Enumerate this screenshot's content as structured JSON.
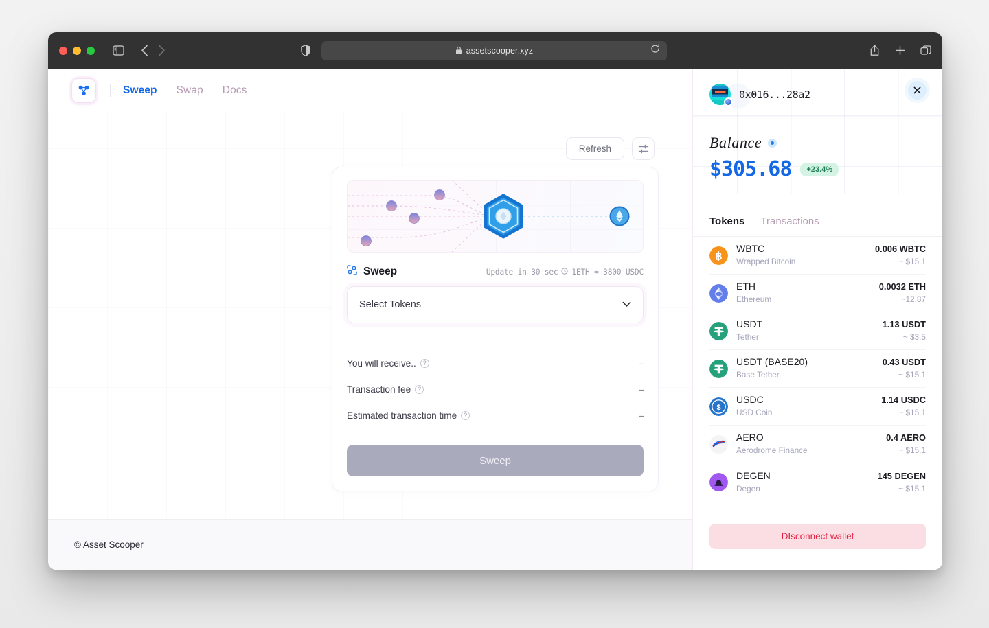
{
  "browser": {
    "url": "assetscooper.xyz",
    "lock_icon": "lock-icon",
    "reload_icon": "reload-icon",
    "sidebar_icon": "sidebar-toggle-icon",
    "back_icon": "chevron-left-icon",
    "forward_icon": "chevron-right-icon",
    "shield_icon": "shield-icon",
    "share_icon": "share-icon",
    "new_tab_icon": "plus-icon",
    "tabs_icon": "tab-overview-icon"
  },
  "nav": {
    "logo_icon": "asset-scooper-logo",
    "links": [
      {
        "label": "Sweep",
        "active": true
      },
      {
        "label": "Swap",
        "active": false
      },
      {
        "label": "Docs",
        "active": false
      }
    ]
  },
  "toolbar": {
    "refresh_label": "Refresh",
    "settings_icon": "sliders-icon"
  },
  "sweep_card": {
    "title": "Sweep",
    "title_icon": "scan-frame-icon",
    "meta_update": "Update in 30 sec",
    "meta_clock_icon": "clock-icon",
    "meta_rate": "1ETH ≈ 3800 USDC",
    "select_tokens_label": "Select Tokens",
    "chevron_icon": "chevron-down-icon",
    "rows": [
      {
        "label": "You will receive..",
        "help_icon": "help-circle-icon",
        "value": "--"
      },
      {
        "label": "Transaction fee",
        "help_icon": "help-circle-icon",
        "value": "--"
      },
      {
        "label": "Estimated transaction time",
        "help_icon": "help-circle-icon",
        "value": "--"
      }
    ],
    "action_label": "Sweep"
  },
  "footer": {
    "copyright": "© Asset Scooper"
  },
  "wallet": {
    "address": "0x016...28a2",
    "avatar_icon": "wallet-blockie-avatar",
    "close_icon": "close-icon",
    "balance_label": "Balance",
    "balance_eye_icon": "eye-toggle-icon",
    "balance_amount": "$305.68",
    "balance_change": "+23.4%",
    "tabs": [
      {
        "label": "Tokens",
        "active": true
      },
      {
        "label": "Transactions",
        "active": false
      }
    ],
    "tokens": [
      {
        "symbol": "WBTC",
        "name": "Wrapped Bitcoin",
        "amount": "0.006 WBTC",
        "usd": "~ $15.1",
        "icon": "wbtc-icon",
        "color": "#f7931a"
      },
      {
        "symbol": "ETH",
        "name": "Ethereum",
        "amount": "0.0032 ETH",
        "usd": "~12.87",
        "icon": "eth-icon",
        "color": "#627eea"
      },
      {
        "symbol": "USDT",
        "name": "Tether",
        "amount": "1.13 USDT",
        "usd": "~ $3.5",
        "icon": "usdt-icon",
        "color": "#26a17b"
      },
      {
        "symbol": "USDT (BASE20)",
        "name": "Base Tether",
        "amount": "0.43 USDT",
        "usd": "~ $15.1",
        "icon": "usdt-icon",
        "color": "#26a17b"
      },
      {
        "symbol": "USDC",
        "name": "USD Coin",
        "amount": "1.14 USDC",
        "usd": "~ $15.1",
        "icon": "usdc-icon",
        "color": "#2775ca"
      },
      {
        "symbol": "AERO",
        "name": "Aerodrome Finance",
        "amount": "0.4 AERO",
        "usd": "~ $15.1",
        "icon": "aero-icon",
        "color": "#f2f2f2"
      },
      {
        "symbol": "DEGEN",
        "name": "Degen",
        "amount": "145 DEGEN",
        "usd": "~ $15.1",
        "icon": "degen-icon",
        "color": "#a058f0"
      }
    ],
    "disconnect_label": "DIsconnect wallet"
  },
  "colors": {
    "accent_blue": "#1068e8",
    "balance_blue": "#1468e6",
    "change_green": "#1f7f56",
    "danger_red": "#e0213f",
    "muted_pink": "#b79bb4"
  }
}
